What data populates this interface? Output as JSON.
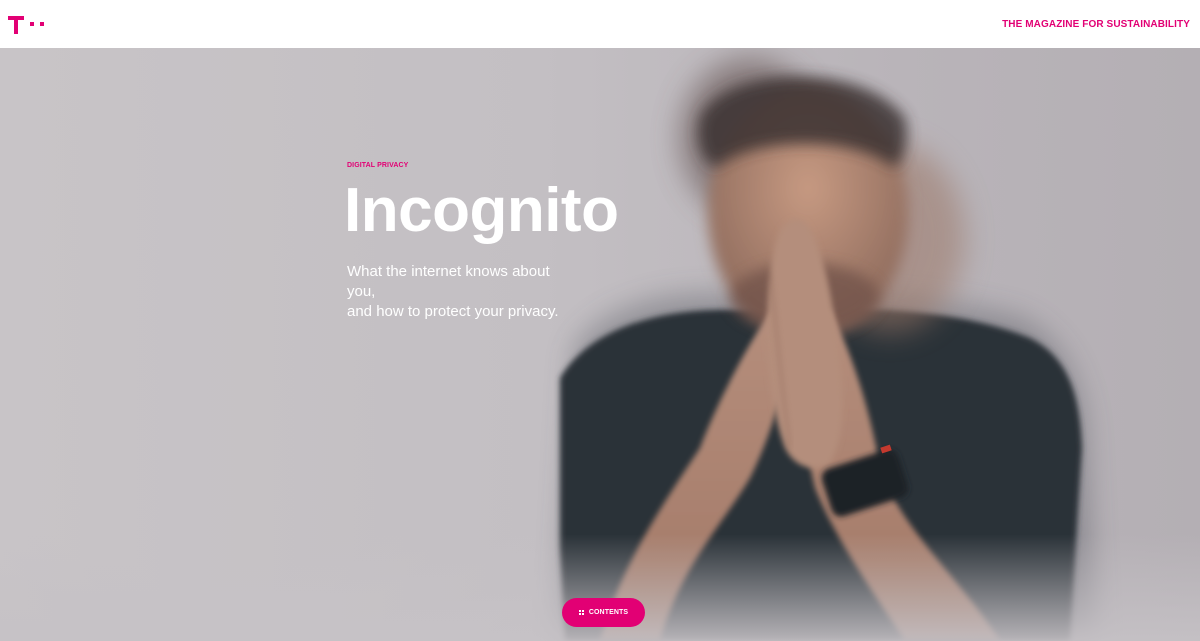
{
  "header": {
    "logo_dots": "· ·",
    "magazine_link": "THE MAGAZINE FOR SUSTAINABILITY",
    "brand_color": "#e20074"
  },
  "hero": {
    "kicker": "DIGITAL PRIVACY",
    "title": "Incognito",
    "subtitle_lines": [
      "What the internet knows about",
      "you,",
      "and how to protect your privacy."
    ],
    "photo": "blurred man with pressed hands, motion-blur portrait"
  },
  "contents_button": {
    "label": "CONTENTS",
    "icon": "grid-icon"
  }
}
